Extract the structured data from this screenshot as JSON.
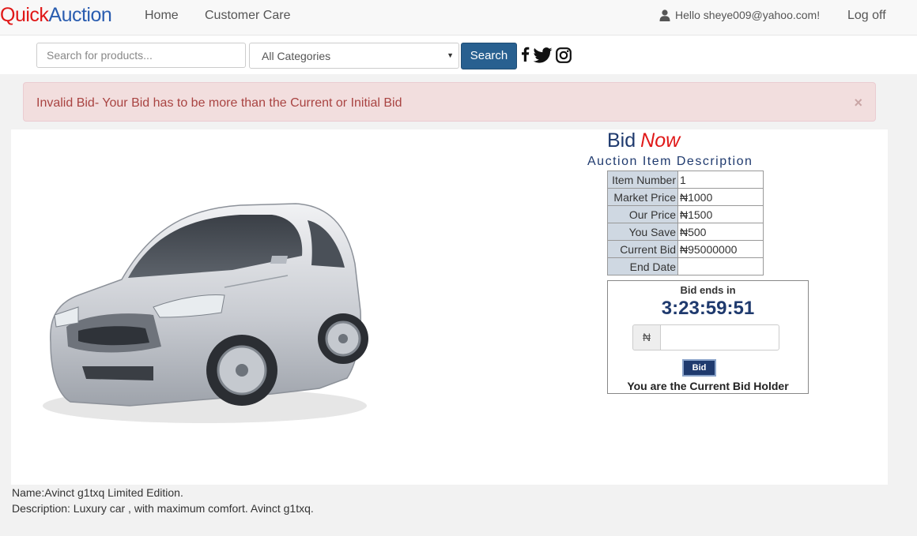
{
  "nav": {
    "brand_part1": "Quick",
    "brand_part2": "Auction",
    "home": "Home",
    "customer_care": "Customer Care",
    "greeting": "Hello sheye009@yahoo.com!",
    "logoff": "Log off"
  },
  "search": {
    "placeholder": "Search for products...",
    "category": "All Categories",
    "button": "Search"
  },
  "social": [
    "facebook-icon",
    "twitter-icon",
    "instagram-icon"
  ],
  "alert": {
    "message": "Invalid Bid- Your Bid has to be more than the Current or Initial Bid",
    "close": "×"
  },
  "bid_panel": {
    "title_part1": "Bid",
    "title_part2": "Now",
    "subtitle": "Auction Item Description",
    "rows": [
      {
        "label": "Item Number",
        "value": "1"
      },
      {
        "label": "Market Price",
        "value": "₦1000"
      },
      {
        "label": "Our Price",
        "value": "₦1500"
      },
      {
        "label": "You Save",
        "value": "₦500"
      },
      {
        "label": "Current Bid",
        "value": "₦95000000"
      },
      {
        "label": "End Date",
        "value": ""
      }
    ],
    "ends_label": "Bid ends in",
    "countdown": "3:23:59:51",
    "currency": "₦",
    "bid_button": "Bid",
    "holder_text": "You are the Current Bid Holder"
  },
  "item": {
    "name": "Name:Avinct g1txq Limited Edition.",
    "description": "Description: Luxury car , with maximum comfort. Avinct g1txq."
  },
  "colors": {
    "brand_red": "#e01818",
    "brand_blue": "#2a5db0",
    "primary_button": "#286090",
    "alert_bg": "#f2dede",
    "alert_text": "#a94442",
    "navy": "#1f3a6e"
  }
}
